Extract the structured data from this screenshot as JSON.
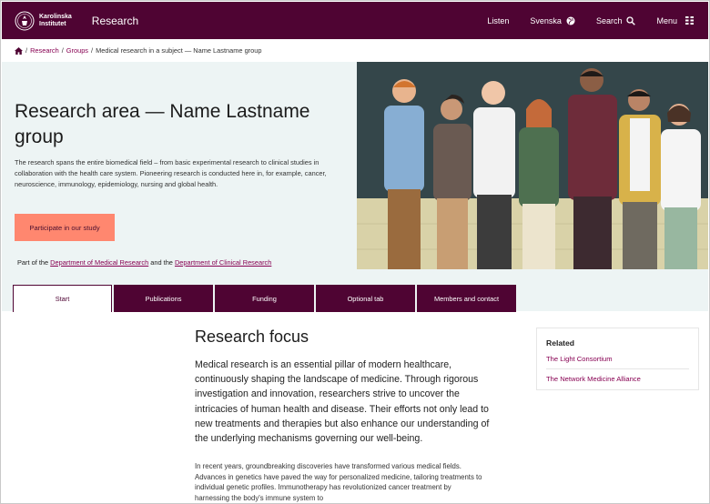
{
  "header": {
    "logo_line1": "Karolinska",
    "logo_line2": "Institutet",
    "site_title": "Research",
    "listen": "Listen",
    "language": "Svenska",
    "search": "Search",
    "menu": "Menu"
  },
  "breadcrumb": {
    "items": [
      "Research",
      "Groups",
      "Medical research in a subject — Name Lastname group"
    ]
  },
  "hero": {
    "title": "Research area — Name Lastname group",
    "description": "The research spans the entire biomedical field – from basic experimental research to clinical studies in collaboration with the health care system. Pioneering research is conducted here in, for example, cancer, neuroscience, immunology, epidemiology, nursing and global health.",
    "cta_label": "Participate in our study",
    "partof_prefix": "Part of the ",
    "dept1": "Department of Medical Research",
    "partof_mid": " and the ",
    "dept2": "Department of Clinical Research"
  },
  "tabs": [
    "Start",
    "Publications",
    "Funding",
    "Optional tab",
    "Members and contact"
  ],
  "content": {
    "title": "Research focus",
    "lead": "Medical research is an essential pillar of modern healthcare, continuously shaping the landscape of medicine. Through rigorous investigation and innovation, researchers strive to uncover the intricacies of human health and disease. Their efforts not only lead to new treatments and therapies but also enhance our understanding of the underlying mechanisms governing our well-being.",
    "body": "In recent years, groundbreaking discoveries have transformed various medical fields. Advances in genetics have paved the way for personalized medicine, tailoring treatments to individual genetic profiles. Immunotherapy has revolutionized cancer treatment by harnessing the body's immune system to"
  },
  "related": {
    "title": "Related",
    "links": [
      "The Light Consortium",
      "The Network Medicine Alliance"
    ]
  },
  "colors": {
    "brand": "#4f0433",
    "link": "#870052",
    "cta": "#ff876f",
    "hero_bg": "#edf4f4"
  }
}
